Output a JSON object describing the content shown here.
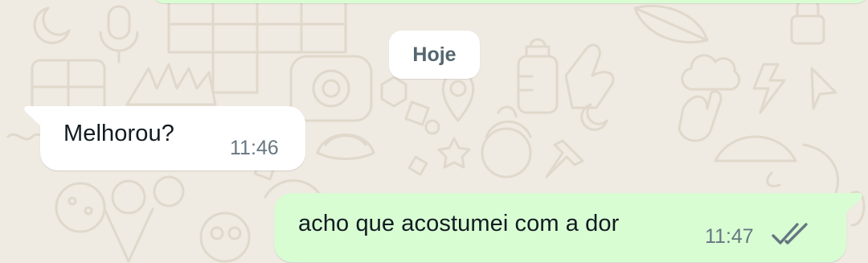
{
  "date_chip": {
    "label": "Hoje"
  },
  "messages": [
    {
      "direction": "incoming",
      "text": "Melhorou?",
      "time": "11:46"
    },
    {
      "direction": "outgoing",
      "text": "acho que acostumei com a dor",
      "time": "11:47",
      "status_icon": "double-check-icon"
    }
  ],
  "colors": {
    "wallpaper": "#efeae2",
    "doodle": "#e0d8cb",
    "incoming_bubble": "#ffffff",
    "outgoing_bubble": "#d9fdd3",
    "text": "#111b21",
    "meta": "#667781"
  }
}
